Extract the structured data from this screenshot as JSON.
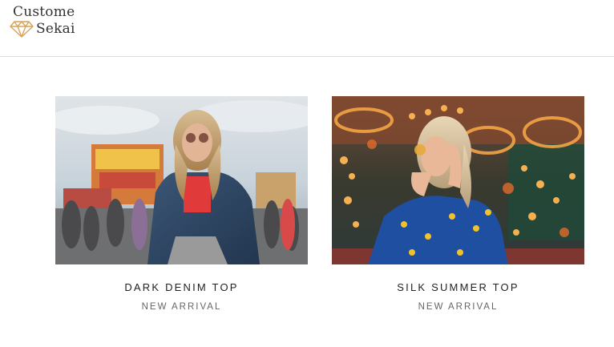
{
  "brand": {
    "name_line1": "Custome",
    "name_line2": "Sekai",
    "logo_icon": "diamond-icon",
    "logo_color": "#d6a45a"
  },
  "products": [
    {
      "title": "DARK DENIM TOP",
      "badge": "NEW ARRIVAL",
      "image": "photo of a woman in a denim jacket at a fair"
    },
    {
      "title": "SILK SUMMER TOP",
      "badge": "NEW ARRIVAL",
      "image": "photo of a woman in a blue printed shirt in front of carnival lights"
    }
  ]
}
